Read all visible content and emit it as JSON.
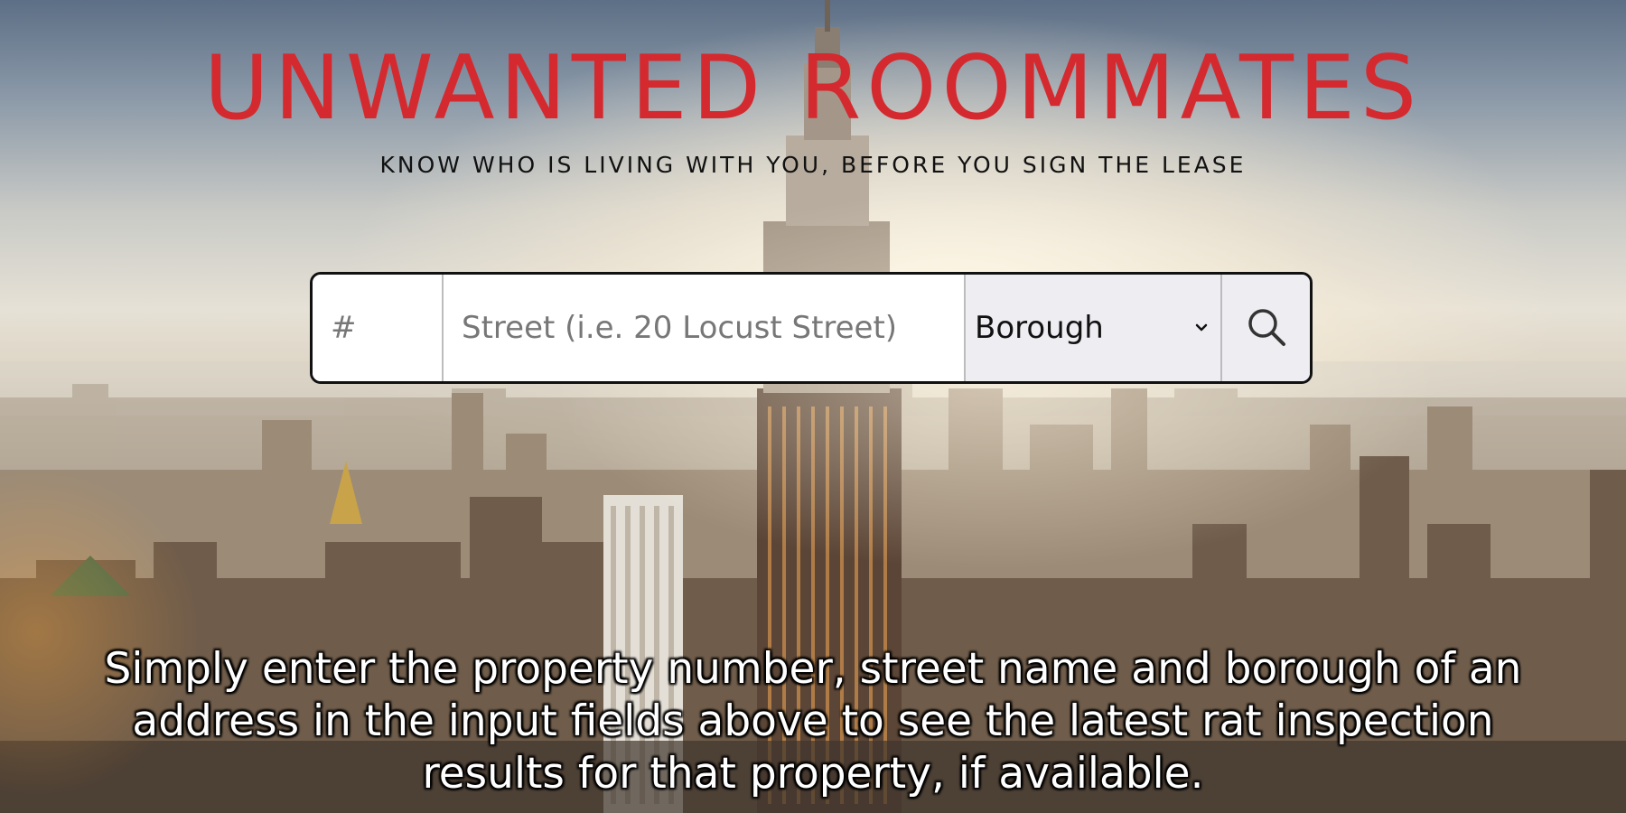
{
  "header": {
    "title": "UNWANTED ROOMMATES",
    "tagline": "KNOW WHO IS LIVING WITH YOU, BEFORE YOU SIGN THE LEASE"
  },
  "search": {
    "number_placeholder": "#",
    "street_placeholder": "Street (i.e. 20 Locust Street)",
    "borough_selected": "Borough",
    "search_icon": "search-icon"
  },
  "instructions": "Simply enter the property number, street name and borough of an address in the input fields above to see the latest rat inspection results for that property, if available.",
  "colors": {
    "title": "#d42a2f",
    "tagline": "#111111",
    "instructions": "#ffffff"
  }
}
